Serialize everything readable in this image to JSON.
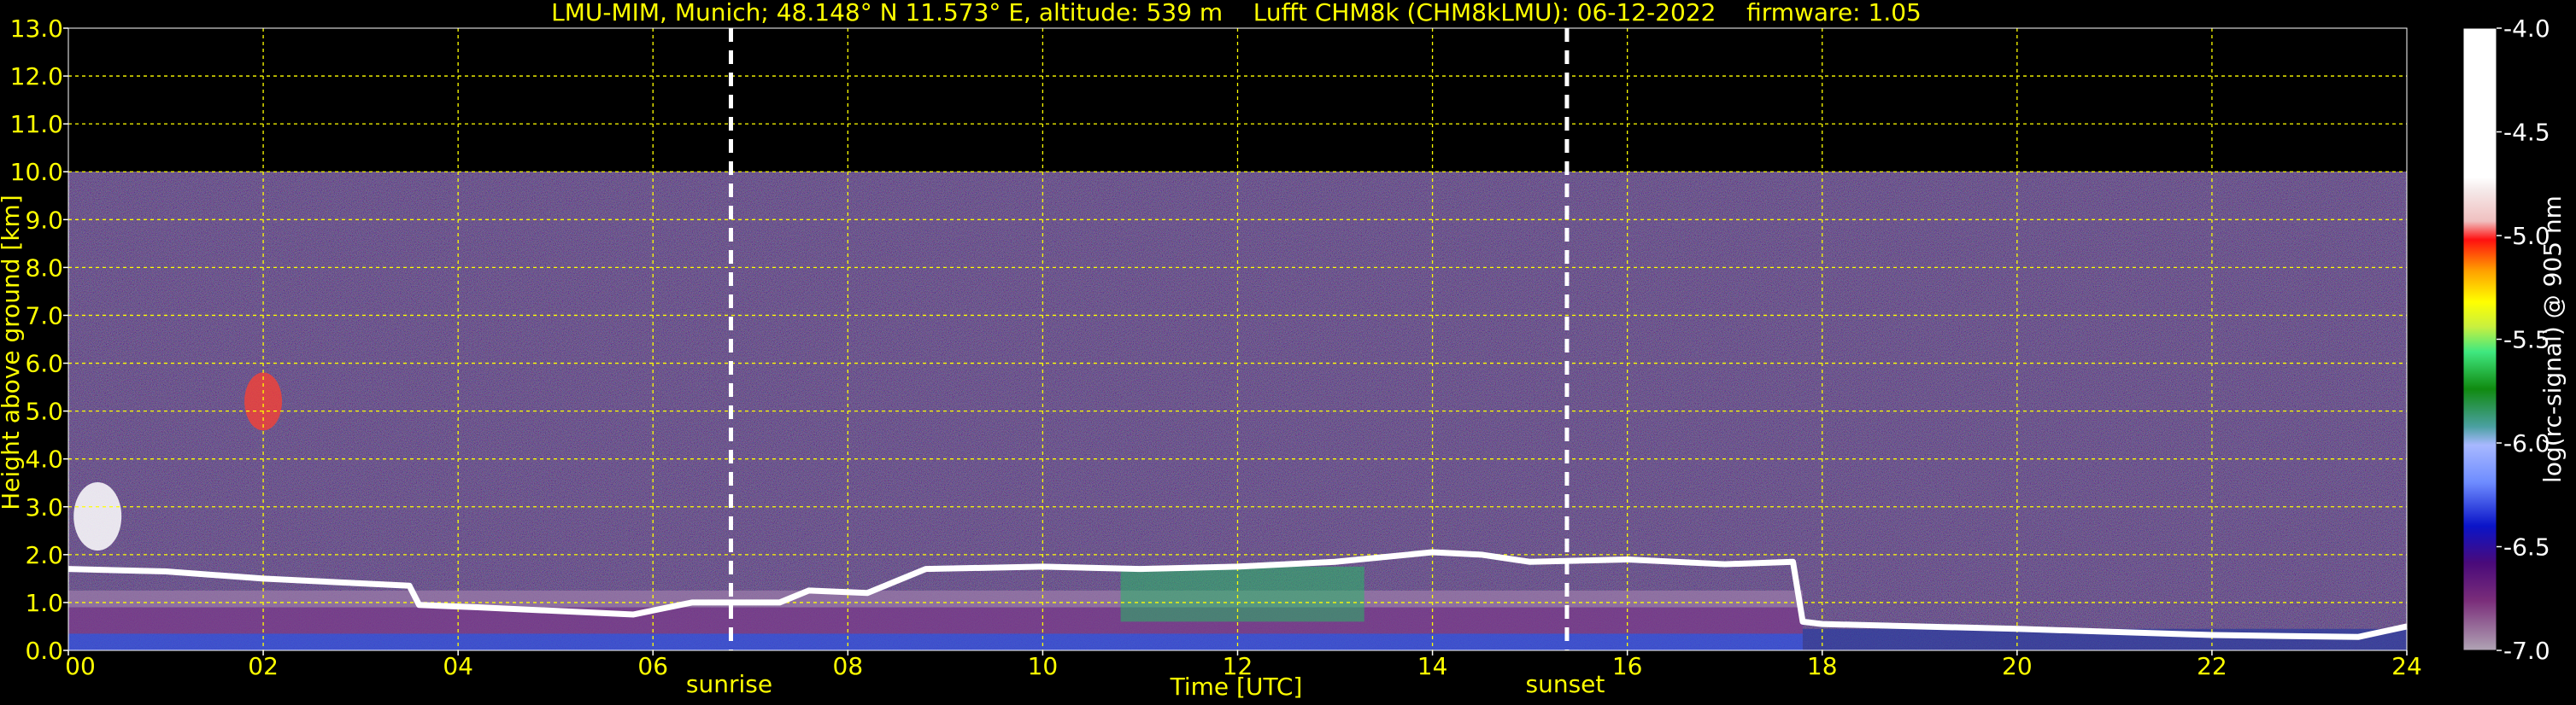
{
  "chart_data": {
    "type": "heatmap",
    "title": "LMU-MIM, Munich; 48.148° N 11.573° E, altitude: 539 m    Lufft CHM8k (CHM8kLMU): 06-12-2022    firmware: 1.05",
    "xlabel": "Time [UTC]",
    "ylabel": "Height above ground [km]",
    "xlim": [
      0,
      24
    ],
    "ylim": [
      0,
      13
    ],
    "x_ticks": [
      "00",
      "02",
      "04",
      "06",
      "08",
      "10",
      "12",
      "14",
      "16",
      "18",
      "20",
      "22",
      "24"
    ],
    "y_ticks": [
      "0.0",
      "1.0",
      "2.0",
      "3.0",
      "4.0",
      "5.0",
      "6.0",
      "7.0",
      "8.0",
      "9.0",
      "10.0",
      "11.0",
      "12.0",
      "13.0"
    ],
    "grid": true,
    "grid_color": "#ffff00",
    "signal_top_km": 10,
    "sunrise": {
      "time": 6.8,
      "label": "sunrise"
    },
    "sunset": {
      "time": 15.38,
      "label": "sunset"
    },
    "colorbar": {
      "label": "log(rc-signal) @ 905 nm",
      "range": [
        -7.0,
        -4.0
      ],
      "ticks": [
        "-7.0",
        "-6.5",
        "-6.0",
        "-5.5",
        "-5.0",
        "-4.5",
        "-4.0"
      ]
    },
    "cloud_base_line": {
      "times": [
        0,
        1,
        2,
        3.5,
        3.6,
        4.2,
        5.8,
        6.4,
        7.3,
        7.6,
        8.2,
        8.8,
        10,
        11,
        12,
        13,
        14,
        14.5,
        15,
        16,
        17,
        17.7,
        17.8,
        18,
        20,
        22,
        23.5,
        24
      ],
      "heights": [
        1.7,
        1.65,
        1.5,
        1.35,
        0.95,
        0.9,
        0.75,
        1.0,
        1.0,
        1.25,
        1.2,
        1.7,
        1.75,
        1.7,
        1.75,
        1.85,
        2.05,
        2.0,
        1.85,
        1.9,
        1.8,
        1.85,
        0.6,
        0.55,
        0.45,
        0.32,
        0.28,
        0.5
      ]
    },
    "colors": {
      "background": "#000000",
      "text": "#ffff00",
      "marker_lines": "#ffffff",
      "cloud_base": "#ffffff"
    }
  }
}
